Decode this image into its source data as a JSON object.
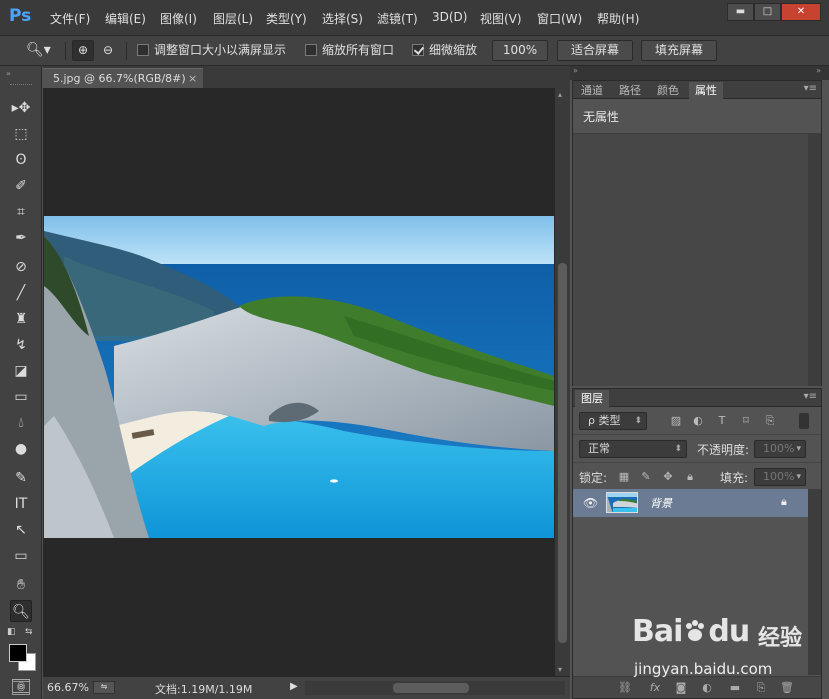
{
  "app": {
    "logo": "Ps",
    "menu": [
      "文件(F)",
      "编辑(E)",
      "图像(I)",
      "图层(L)",
      "类型(Y)",
      "选择(S)",
      "滤镜(T)",
      "3D(D)",
      "视图(V)",
      "窗口(W)",
      "帮助(H)"
    ],
    "window_buttons": {
      "minimize": "▬",
      "maximize": "□",
      "close": "✕"
    }
  },
  "options": {
    "resize_windows_label": "调整窗口大小以满屏显示",
    "resize_windows_checked": false,
    "zoom_all_label": "缩放所有窗口",
    "zoom_all_checked": false,
    "scrubby_zoom_label": "细微缩放",
    "scrubby_zoom_checked": true,
    "btn_100": "100%",
    "btn_fit": "适合屏幕",
    "btn_fill": "填充屏幕"
  },
  "document": {
    "tab_title": "5.jpg @ 66.7%(RGB/8#)",
    "tab_close": "×",
    "zoom": "66.67%",
    "doc_info": "文档:1.19M/1.19M"
  },
  "panels": {
    "props_tabs": [
      "通道",
      "路径",
      "颜色",
      "属性"
    ],
    "props_active": "属性",
    "props_title": "无属性",
    "layers_tab": "图层",
    "filter_kind": "ρ 类型",
    "blend_mode": "正常",
    "opacity_label": "不透明度:",
    "opacity_value": "100%",
    "lock_label": "锁定:",
    "fill_label": "填充:",
    "fill_value": "100%",
    "layer_name": "背景"
  },
  "watermark": {
    "brand": "Bai",
    "brand_tail": "du",
    "product": "经验",
    "url": "jingyan.baidu.com"
  },
  "colors": {
    "accent": "#4aa3ff",
    "selected_layer": "#6b7b94",
    "close_button": "#c84231"
  }
}
